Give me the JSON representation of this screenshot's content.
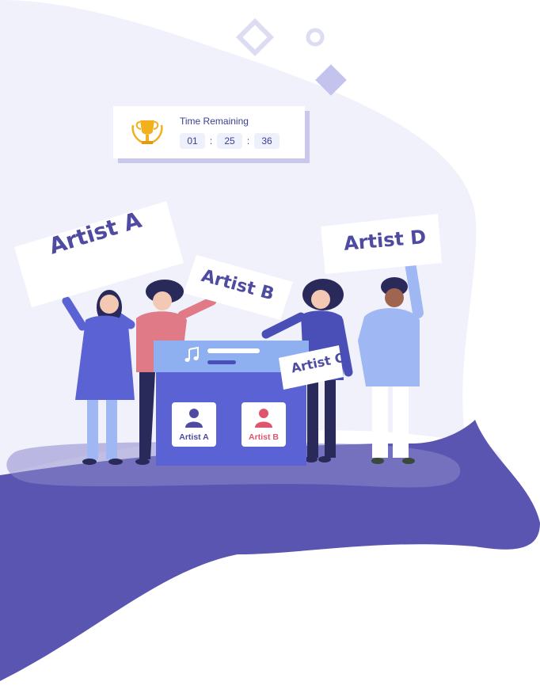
{
  "timer": {
    "title": "Time Remaining",
    "hours": "01",
    "minutes": "25",
    "seconds": "36",
    "separator": ":",
    "icon": "trophy-icon"
  },
  "signs": {
    "a": "Artist A",
    "b": "Artist B",
    "c": "Artist C",
    "d": "Artist D"
  },
  "ballot": {
    "icon": "music-note-icon",
    "option_a": "Artist A",
    "option_b": "Artist B"
  },
  "colors": {
    "brand_purple": "#5a55b0",
    "background_lavender": "#f1f1fc",
    "accent_blue": "#5b63d4",
    "accent_pink": "#e0556c",
    "trophy_gold": "#f2b01e"
  }
}
